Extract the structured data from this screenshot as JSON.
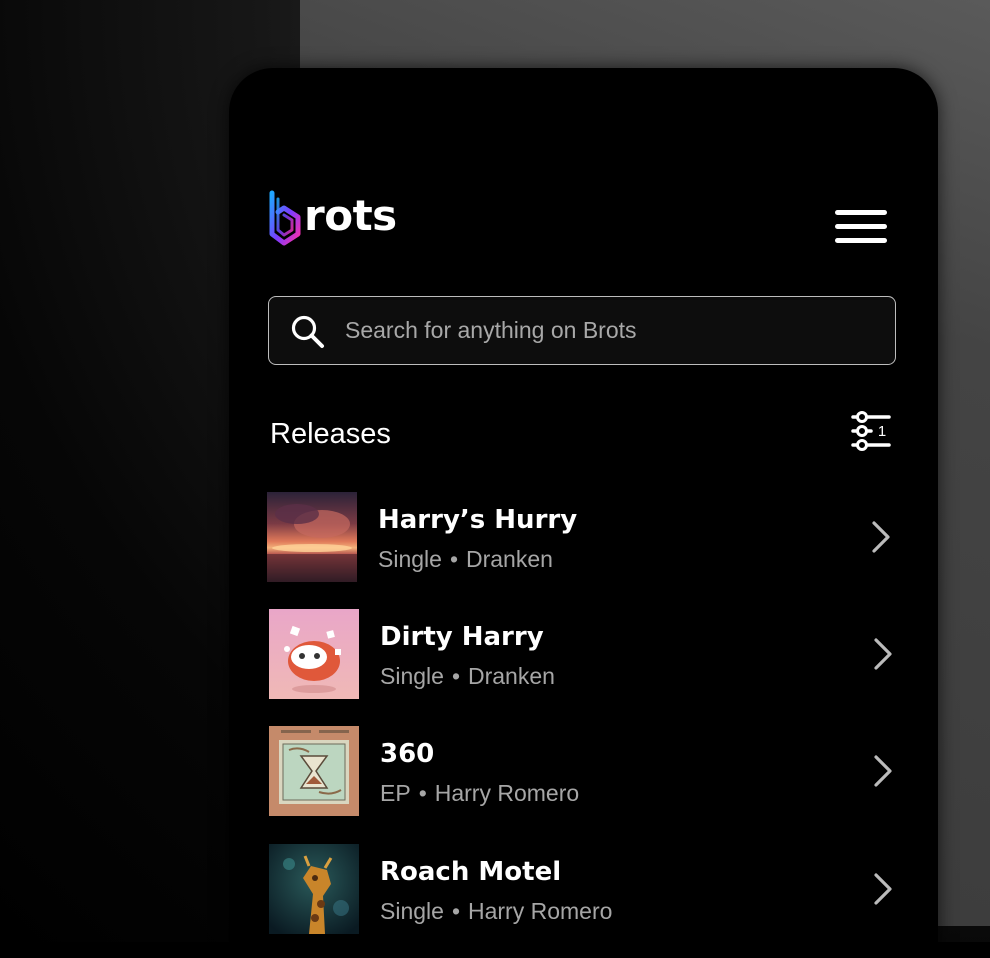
{
  "brand": {
    "name": "rots",
    "mark_icon": "brots-b-logo-icon"
  },
  "header": {
    "menu_icon": "hamburger-menu-icon"
  },
  "search": {
    "placeholder": "Search for anything on Brots",
    "value": "",
    "icon": "search-icon"
  },
  "section": {
    "title": "Releases",
    "filter_icon": "filter-sliders-icon",
    "filter_count": "1"
  },
  "releases": [
    {
      "title": "Harry’s Hurry",
      "type": "Single",
      "separator": "•",
      "artist": "Dranken",
      "cover": "sunset-clouds-over-water"
    },
    {
      "title": "Dirty Harry",
      "type": "Single",
      "separator": "•",
      "artist": "Dranken",
      "cover": "game-controller-on-pink"
    },
    {
      "title": "360",
      "type": "EP",
      "separator": "•",
      "artist": "Harry Romero",
      "cover": "hourglass-hands-illustration"
    },
    {
      "title": "Roach Motel",
      "type": "Single",
      "separator": "•",
      "artist": "Harry Romero",
      "cover": "giraffe-painting"
    }
  ],
  "colors": {
    "background": "#000000",
    "text": "#ffffff",
    "muted_text": "#a6a6a6",
    "logo_gradient": [
      "#1fa8ff",
      "#7b3cff",
      "#ff2fa8"
    ]
  }
}
